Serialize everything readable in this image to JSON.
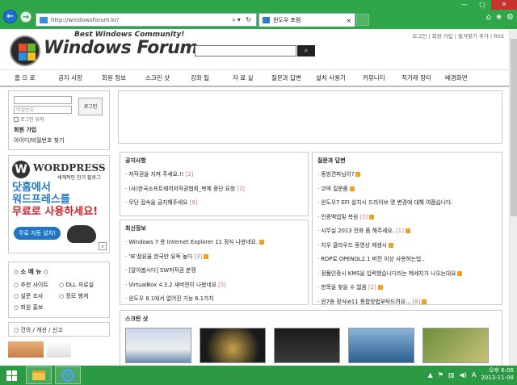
{
  "browser": {
    "url": "http://windowsforum.kr/",
    "tab_title": "윈도우 포럼",
    "tab_close": "×"
  },
  "site": {
    "tagline": "Best Windows Community!",
    "logo_text": "Windows Forum",
    "toplinks": "로그인 | 회원 가입 | 즐겨찾기 추가 | RSS",
    "menu": [
      "홈 으 로",
      "공지 사항",
      "회원 정보",
      "스크린 샷",
      "강좌 팁",
      "자 료 실",
      "질문과 답변",
      "설치 사용기",
      "커뮤니티",
      "직거래 장터",
      "배경화면"
    ]
  },
  "login": {
    "id_placeholder": "",
    "pw_placeholder": "비밀번호",
    "button": "로그인",
    "keep": "로그인 유지",
    "join": "회원 가입",
    "find": "아이디/비밀번호 찾기"
  },
  "ad": {
    "brand": "WORDPRESS",
    "sub": "세계적인 인기 블로그",
    "line1": "닷홈에서",
    "line2": "워드프레스를",
    "line3": "무료로 사용하세요!",
    "install": "무료 자동 설치!"
  },
  "small_menu": {
    "title": "◇ 소 메 뉴 ◇",
    "items": [
      "○ 추천 사이트",
      "○ DLL 자료실",
      "○ 설문 조사",
      "○ 정모 행게",
      "○ 회원 홍보"
    ]
  },
  "report": "○ 건의 / 개선 / 신고",
  "notice": {
    "title": "공지사항",
    "items": [
      {
        "text": "· 저작권을 지켜 주세요.!!",
        "count": "[2]"
      },
      {
        "text": "· (사)한국소프트웨어저작권협회_복제 중단 요청",
        "count": "[2]"
      },
      {
        "text": "· 무단 접속을 금지해주세요",
        "count": "[9]"
      }
    ]
  },
  "latest": {
    "title": "최신정보",
    "items": [
      {
        "text": "· Windows 7 용 Internet Explorer 11 정식 나왔네요.",
        "count": ""
      },
      {
        "text": "· 'IE'점유율 한국만 유독 높다",
        "count": "[3]"
      },
      {
        "text": "· [알아봅시다] SW저작권 분쟁",
        "count": ""
      },
      {
        "text": "· VirtualBox 4.3.2 새버전이 나왔네요",
        "count": "[5]"
      },
      {
        "text": "· 윈도우 8.1에서 없어진 기능 6.1가지",
        "count": ""
      }
    ]
  },
  "qna": {
    "title": "질문과 답변",
    "items": [
      {
        "text": "· 동방견파님이?",
        "count": ""
      },
      {
        "text": "· 코덱 질문좀",
        "count": ""
      },
      {
        "text": "· 윈도우7 EFI 설치시 드라이브 명 변경에 대해 여쭙습니다.",
        "count": ""
      },
      {
        "text": "· 인증백업및 복원",
        "count": "[2]"
      },
      {
        "text": "· 사무실 2013 전화 좀 해주세요.",
        "count": "[1]"
      },
      {
        "text": "· 치우 클라우드 동영상 재생시",
        "count": ""
      },
      {
        "text": "· RDP로 OPENGL2.1 버전 이상 사용하는법..",
        "count": ""
      },
      {
        "text": "· 정품인증시 KMS을 입력했습니다라는 메세지가 나오는대요",
        "count": ""
      },
      {
        "text": "· 항목을 찾을 수 없음",
        "count": "[2]"
      },
      {
        "text": "· 윈7용 정식ie11 통합방법부탁드려요...",
        "count": "[8]"
      }
    ]
  },
  "screenshots": {
    "title": "스크린 샷",
    "count": 5
  },
  "taskbar": {
    "time": "오후 6:06",
    "date": "2013-11-08",
    "ime": "A"
  },
  "colors": {
    "titlebar": "#2fa64a",
    "taskbar": "#2c9a45",
    "accent": "#1f77c4"
  }
}
